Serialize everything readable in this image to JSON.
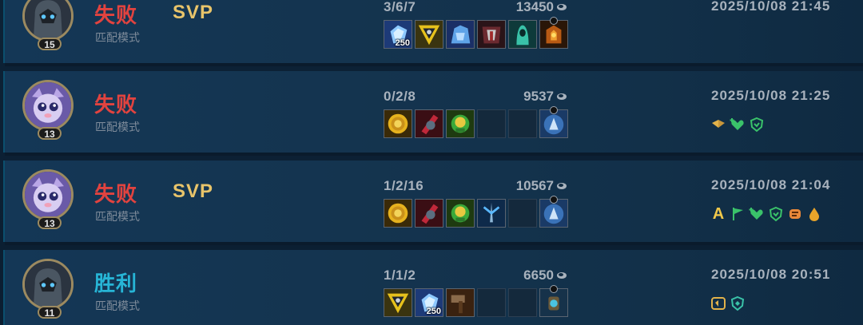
{
  "matches": [
    {
      "result": "失败",
      "result_type": "loss",
      "mode": "匹配模式",
      "level": "15",
      "champion_icon": "armored-champion-icon",
      "svp": "SVP",
      "kda": "3/6/7",
      "gold": "13450",
      "datetime": "2025/10/08 21:45",
      "items": [
        {
          "icon": "crystal-shard-item-icon",
          "stack": "250"
        },
        {
          "icon": "golden-triangle-item-icon",
          "stack": ""
        },
        {
          "icon": "frost-golem-item-icon",
          "stack": ""
        },
        {
          "icon": "dark-armor-item-icon",
          "stack": ""
        },
        {
          "icon": "hooded-spirit-item-icon",
          "stack": ""
        },
        {
          "icon": "flame-armor-item-icon",
          "stack": ""
        }
      ],
      "badges": []
    },
    {
      "result": "失败",
      "result_type": "loss",
      "mode": "匹配模式",
      "level": "13",
      "champion_icon": "yuumi-cat-champion-icon",
      "svp": "",
      "kda": "0/2/8",
      "gold": "9537",
      "datetime": "2025/10/08 21:25",
      "items": [
        {
          "icon": "golden-sun-item-icon",
          "stack": ""
        },
        {
          "icon": "crimson-blade-item-icon",
          "stack": ""
        },
        {
          "icon": "emerald-mask-item-icon",
          "stack": ""
        },
        {
          "icon": "empty-slot",
          "stack": ""
        },
        {
          "icon": "empty-slot",
          "stack": ""
        },
        {
          "icon": "ward-trinket-item-icon",
          "stack": ""
        }
      ],
      "badges": [
        "wings-badge-icon",
        "heal-heart-badge-icon",
        "shield-badge-icon"
      ]
    },
    {
      "result": "失败",
      "result_type": "loss",
      "mode": "匹配模式",
      "level": "13",
      "champion_icon": "yuumi-cat-champion-icon",
      "svp": "SVP",
      "kda": "1/2/16",
      "gold": "10567",
      "datetime": "2025/10/08 21:04",
      "items": [
        {
          "icon": "golden-sun-item-icon",
          "stack": ""
        },
        {
          "icon": "crimson-blade-item-icon",
          "stack": ""
        },
        {
          "icon": "emerald-mask-item-icon",
          "stack": ""
        },
        {
          "icon": "lightning-staff-item-icon",
          "stack": ""
        },
        {
          "icon": "empty-slot",
          "stack": ""
        },
        {
          "icon": "ward-trinket-item-icon",
          "stack": ""
        }
      ],
      "badges": [
        "A",
        "flag-badge-icon",
        "heal-heart-badge-icon",
        "shield-badge-icon",
        "fist-badge-icon",
        "flame-drop-badge-icon"
      ]
    },
    {
      "result": "胜利",
      "result_type": "win",
      "mode": "匹配模式",
      "level": "11",
      "champion_icon": "armored-champion-icon",
      "svp": "",
      "kda": "1/1/2",
      "gold": "6650",
      "datetime": "2025/10/08 20:51",
      "items": [
        {
          "icon": "golden-triangle-item-icon",
          "stack": ""
        },
        {
          "icon": "crystal-shard-item-icon",
          "stack": "250"
        },
        {
          "icon": "war-hammer-item-icon",
          "stack": ""
        },
        {
          "icon": "empty-slot",
          "stack": ""
        },
        {
          "icon": "empty-slot",
          "stack": ""
        },
        {
          "icon": "lantern-trinket-item-icon",
          "stack": ""
        }
      ],
      "badges": [
        "wings-shield-badge-icon",
        "diamond-shield-badge-icon"
      ]
    }
  ],
  "colors": {
    "loss": "#e2433f",
    "win": "#27b5d6",
    "svp": "#e8c46a",
    "muted_text": "#a8b2bd"
  }
}
